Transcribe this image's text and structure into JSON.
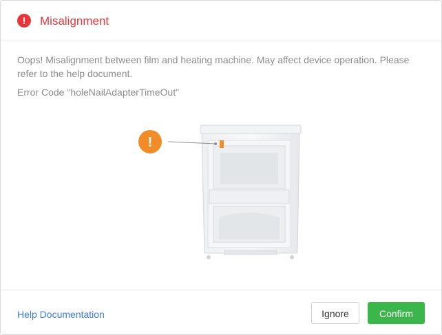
{
  "dialog": {
    "title": "Misalignment",
    "alert_icon_glyph": "!",
    "alert_icon": "exclamation-circle-icon",
    "message": "Oops! Misalignment between film and heating machine. May affect device operation. Please refer to the help document.",
    "error_code": "Error Code \"holeNailAdapterTimeOut\"",
    "illustration": {
      "warning_glyph": "!",
      "warning_icon": "exclamation-circle-icon",
      "warning_color": "#f28c28"
    }
  },
  "footer": {
    "help_link": "Help Documentation",
    "ignore_label": "Ignore",
    "confirm_label": "Confirm"
  },
  "colors": {
    "error_red": "#e5373b",
    "confirm_green": "#3bb64a",
    "link_blue": "#3a7be0",
    "text_grey": "#8c8c8c"
  }
}
